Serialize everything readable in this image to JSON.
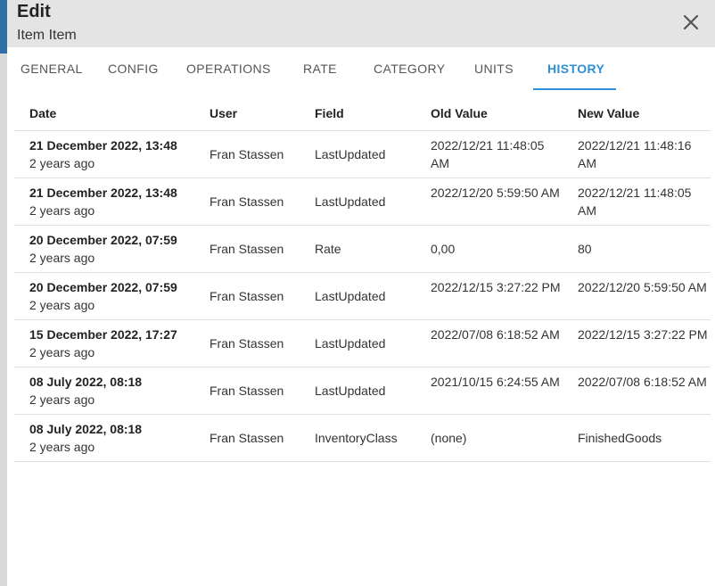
{
  "header": {
    "title": "Edit",
    "subtitle": "Item Item"
  },
  "tabs": [
    {
      "label": "GENERAL"
    },
    {
      "label": "CONFIG"
    },
    {
      "label": "OPERATIONS"
    },
    {
      "label": "RATE"
    },
    {
      "label": "CATEGORY"
    },
    {
      "label": "UNITS"
    },
    {
      "label": "HISTORY",
      "active": true
    }
  ],
  "table": {
    "columns": [
      "Date",
      "User",
      "Field",
      "Old Value",
      "New Value"
    ],
    "rows": [
      {
        "date": "21 December 2022, 13:48",
        "relative": "2 years ago",
        "user": "Fran Stassen",
        "field": "LastUpdated",
        "old_value": "2022/12/21 11:48:05 AM",
        "new_value": "2022/12/21 11:48:16 AM"
      },
      {
        "date": "21 December 2022, 13:48",
        "relative": "2 years ago",
        "user": "Fran Stassen",
        "field": "LastUpdated",
        "old_value": "2022/12/20 5:59:50 AM",
        "new_value": "2022/12/21 11:48:05 AM"
      },
      {
        "date": "20 December 2022, 07:59",
        "relative": "2 years ago",
        "user": "Fran Stassen",
        "field": "Rate",
        "old_value": "0,00",
        "new_value": "80"
      },
      {
        "date": "20 December 2022, 07:59",
        "relative": "2 years ago",
        "user": "Fran Stassen",
        "field": "LastUpdated",
        "old_value": "2022/12/15 3:27:22 PM",
        "new_value": "2022/12/20 5:59:50 AM"
      },
      {
        "date": "15 December 2022, 17:27",
        "relative": "2 years ago",
        "user": "Fran Stassen",
        "field": "LastUpdated",
        "old_value": "2022/07/08 6:18:52 AM",
        "new_value": "2022/12/15 3:27:22 PM"
      },
      {
        "date": "08 July 2022, 08:18",
        "relative": "2 years ago",
        "user": "Fran Stassen",
        "field": "LastUpdated",
        "old_value": "2021/10/15 6:24:55 AM",
        "new_value": "2022/07/08 6:18:52 AM"
      },
      {
        "date": "08 July 2022, 08:18",
        "relative": "2 years ago",
        "user": "Fran Stassen",
        "field": "InventoryClass",
        "old_value": "(none)",
        "new_value": "FinishedGoods"
      }
    ]
  },
  "colors": {
    "accent": "#2d8fd8",
    "header_bg": "#e4e4e4"
  },
  "icons": {
    "close": "close-icon"
  }
}
